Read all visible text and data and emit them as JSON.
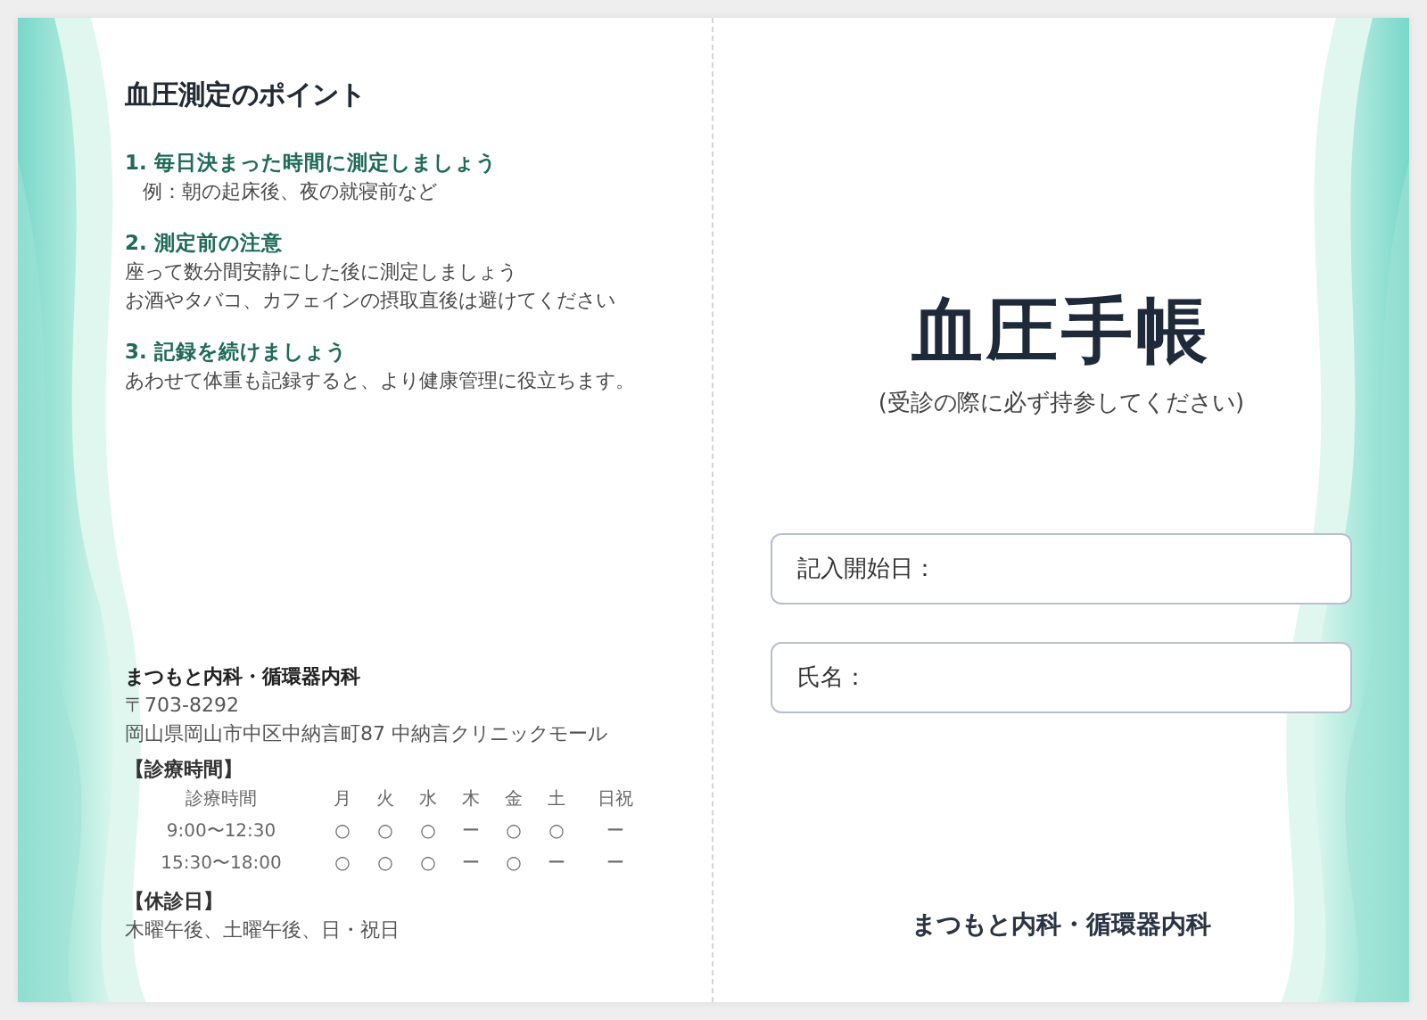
{
  "left_page": {
    "heading": "血圧測定のポイント",
    "points": [
      {
        "title": "1. 毎日決まった時間に測定しましょう",
        "indented": true,
        "lines": [
          "例：朝の起床後、夜の就寝前など"
        ]
      },
      {
        "title": "2. 測定前の注意",
        "indented": false,
        "lines": [
          "座って数分間安静にした後に測定しましょう",
          "お酒やタバコ、カフェインの摂取直後は避けてください"
        ]
      },
      {
        "title": "3. 記録を続けましょう",
        "indented": false,
        "lines": [
          "あわせて体重も記録すると、より健康管理に役立ちます。"
        ]
      }
    ],
    "clinic": {
      "name": "まつもと内科・循環器内科",
      "postal": "〒703-8292",
      "address": "岡山県岡山市中区中納言町87 中納言クリニックモール",
      "hours_heading": "【診療時間】",
      "schedule": {
        "columns": [
          "診療時間",
          "月",
          "火",
          "水",
          "木",
          "金",
          "土",
          "日祝"
        ],
        "rows": [
          {
            "cells": [
              "9:00〜12:30",
              "○",
              "○",
              "○",
              "ー",
              "○",
              "○",
              "ー"
            ]
          },
          {
            "cells": [
              "15:30〜18:00",
              "○",
              "○",
              "○",
              "ー",
              "○",
              "ー",
              "ー"
            ]
          }
        ]
      },
      "closed_heading": "【休診日】",
      "closed_days": "木曜午後、土曜午後、日・祝日"
    }
  },
  "right_page": {
    "title": "血圧手帳",
    "subtitle": "(受診の際に必ず持参してください)",
    "fields": [
      {
        "label": "記入開始日："
      },
      {
        "label": "氏名："
      }
    ],
    "footer": "まつもと内科・循環器内科"
  }
}
